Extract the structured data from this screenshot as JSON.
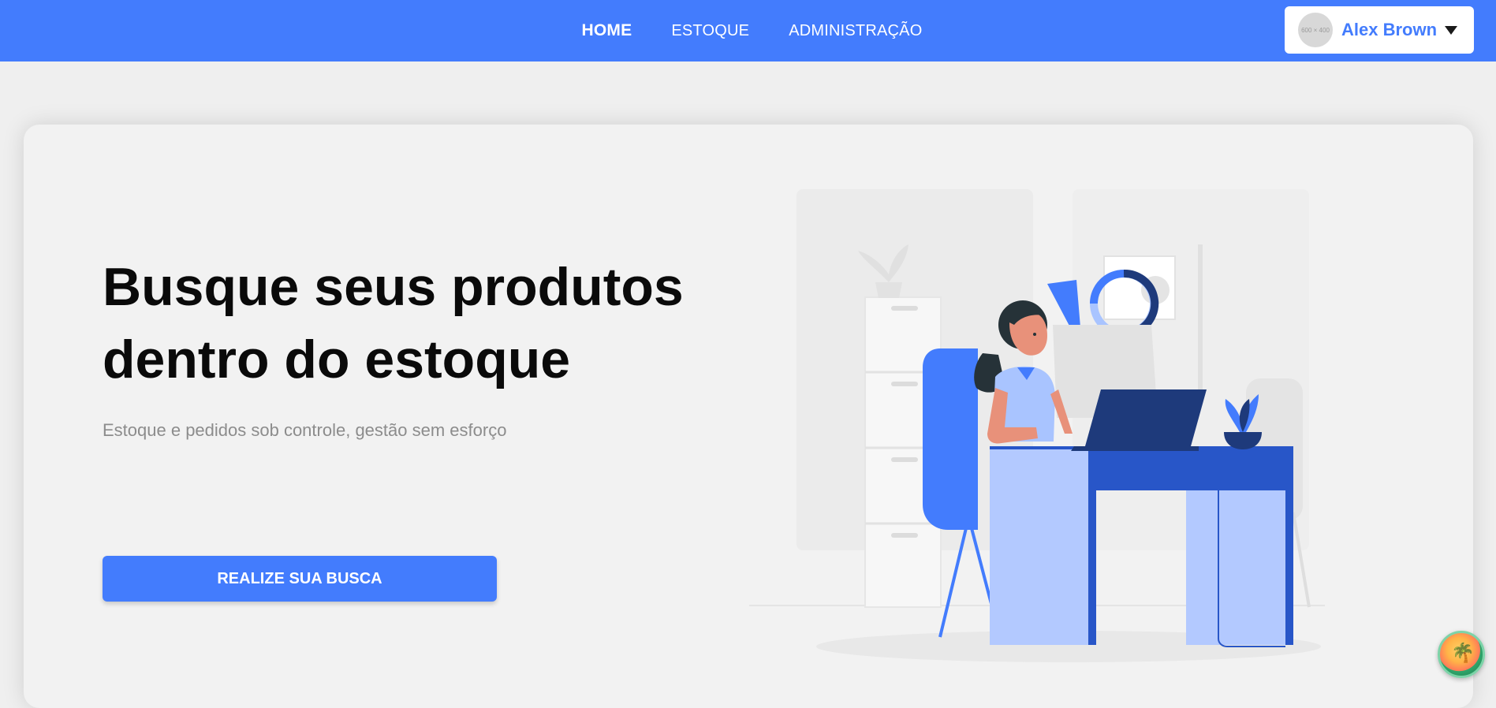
{
  "nav": {
    "items": [
      {
        "label": "HOME",
        "active": true
      },
      {
        "label": "ESTOQUE",
        "active": false
      },
      {
        "label": "ADMINISTRAÇÃO",
        "active": false
      }
    ]
  },
  "user": {
    "name": "Alex Brown",
    "avatar_placeholder": "600 × 400"
  },
  "hero": {
    "title_line1": "Busque seus produtos",
    "title_line2": "dentro do estoque",
    "subtitle": "Estoque e pedidos sob controle, gestão sem esforço",
    "cta_label": "REALIZE SUA BUSCA"
  },
  "colors": {
    "accent": "#437cfd",
    "page_bg": "#efefef",
    "card_bg": "#f2f2f2",
    "title": "#0a0a0a",
    "subtitle": "#8c8c8c"
  },
  "icons": {
    "dropdown": "caret-down-icon",
    "floating": "palm-badge-icon"
  }
}
